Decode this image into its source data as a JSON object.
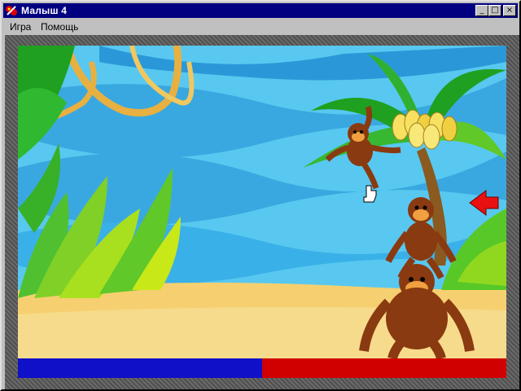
{
  "window": {
    "title": "Малыш 4",
    "controls": {
      "minimize": "_",
      "maximize": "□",
      "close": "×"
    }
  },
  "menu": {
    "items": [
      {
        "label": "Игра"
      },
      {
        "label": "Помощь"
      }
    ]
  },
  "game": {
    "scene": "jungle-beach",
    "characters": [
      "monkey-hanging",
      "monkey-small",
      "monkey-big"
    ],
    "arrow_direction": "left",
    "arrow_color": "#e81010",
    "cursor": "hand-pointer-icon"
  },
  "progress": {
    "fraction": 0.5,
    "left_color": "#1010c8",
    "right_color": "#d00000"
  }
}
